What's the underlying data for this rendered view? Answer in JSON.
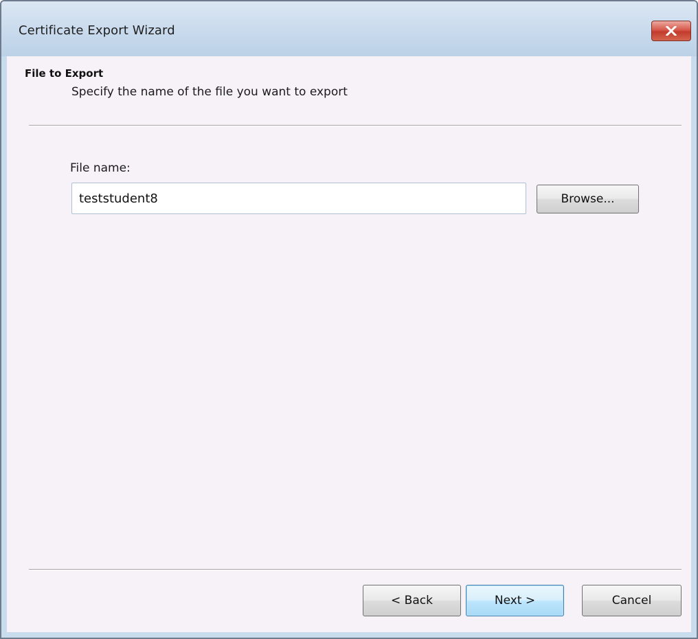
{
  "window": {
    "title": "Certificate Export Wizard",
    "close_icon": "close-icon"
  },
  "header": {
    "title": "File to Export",
    "subtitle": "Specify the name of the file you want to export"
  },
  "form": {
    "file_name_label": "File name:",
    "file_name_value": "teststudent8",
    "browse_label": "Browse..."
  },
  "footer": {
    "back_label": "< Back",
    "next_label": "Next >",
    "cancel_label": "Cancel"
  },
  "colors": {
    "titlebar": "#c7d9ec",
    "content_bg": "#f6f2f7",
    "close_button": "#c9463a",
    "default_button_border": "#3c7fb1"
  }
}
